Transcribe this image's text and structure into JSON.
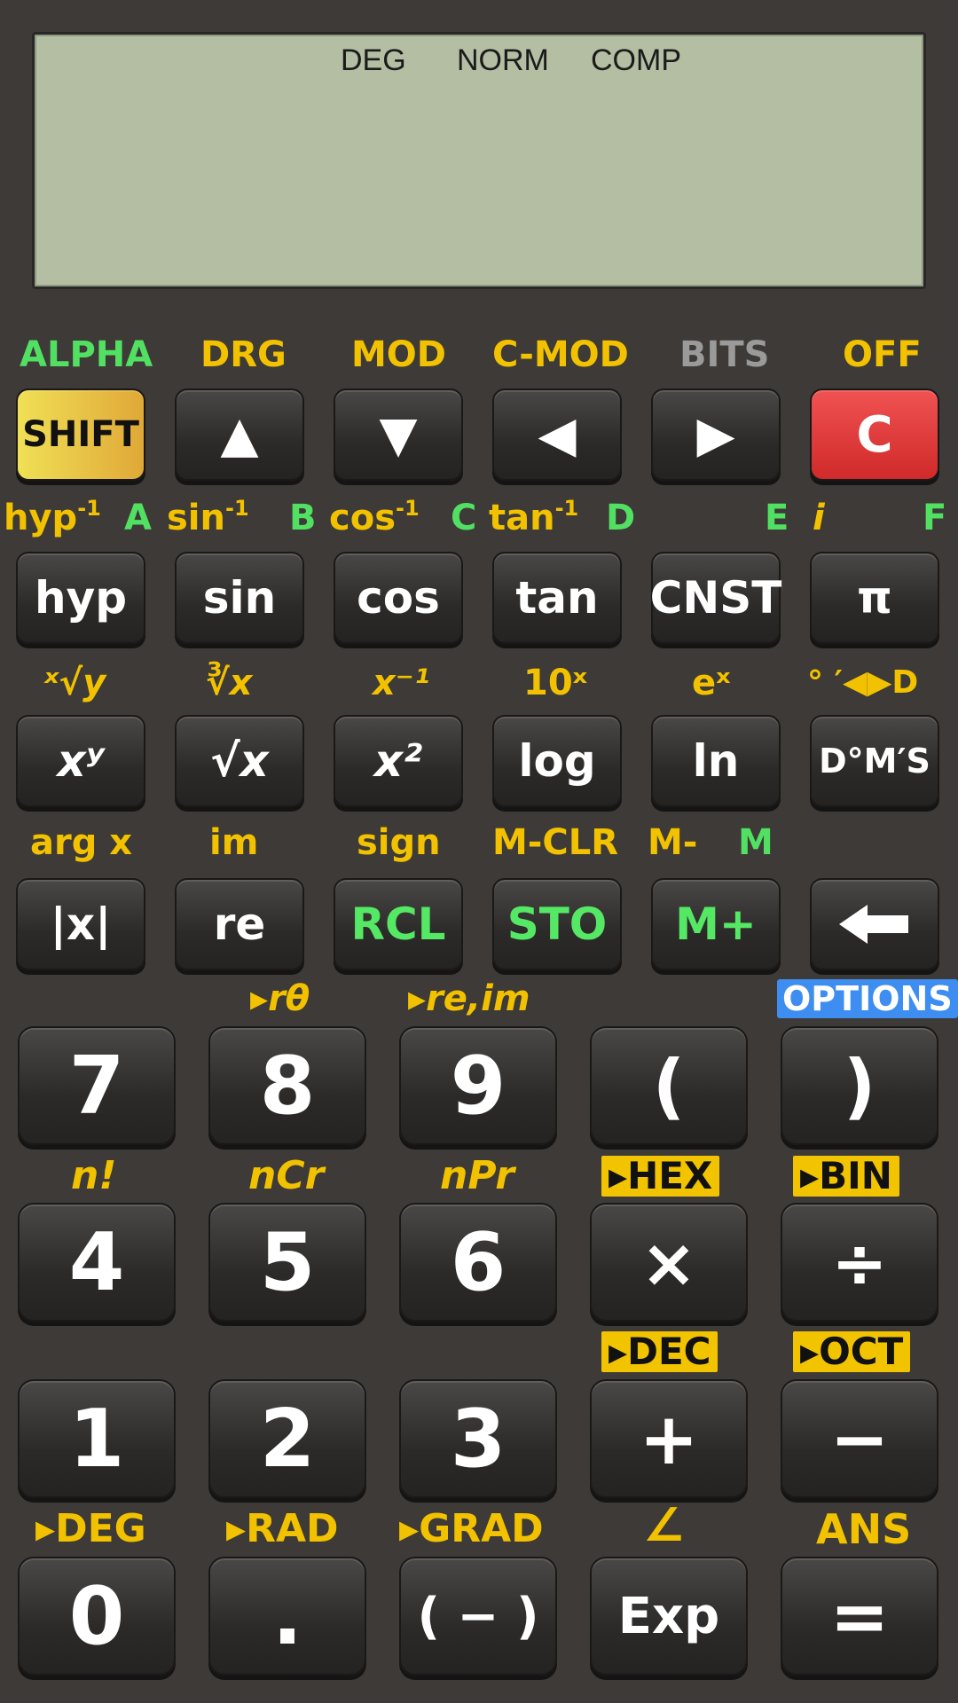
{
  "display": {
    "status": [
      "DEG",
      "NORM",
      "COMP"
    ]
  },
  "row1": {
    "labels": [
      "ALPHA",
      "DRG",
      "MOD",
      "C-MOD",
      "BITS",
      "OFF"
    ],
    "keys": [
      "SHIFT",
      "▲",
      "▼",
      "◀",
      "▶",
      "C"
    ]
  },
  "row2": {
    "labels": {
      "hyp_inv": "hyp",
      "sin_inv": "sin",
      "cos_inv": "cos",
      "tan_inv": "tan",
      "inv_sup": "-1",
      "A": "A",
      "B": "B",
      "C": "C",
      "D": "D",
      "E": "E",
      "i": "i",
      "F": "F"
    },
    "keys": [
      "hyp",
      "sin",
      "cos",
      "tan",
      "CNST",
      "π"
    ]
  },
  "row3": {
    "labels": [
      "ˣ√y",
      "∛x",
      "x⁻¹",
      "10ˣ",
      "eˣ",
      "° ′◀▶D"
    ],
    "keys": [
      "xʸ",
      "√x",
      "x²",
      "log",
      "ln",
      "D°M′S"
    ]
  },
  "row4": {
    "labels": {
      "argx": "arg x",
      "im": "im",
      "sign": "sign",
      "mclr": "M-CLR",
      "mminus": "M-",
      "m": "M"
    },
    "keys": [
      "|x|",
      "re",
      "RCL",
      "STO",
      "M+",
      "backspace"
    ]
  },
  "row5": {
    "labels": {
      "rtheta": "▸rθ",
      "reim": "▸re,im",
      "options": "OPTIONS"
    },
    "keys": [
      "7",
      "8",
      "9",
      "(",
      ")"
    ]
  },
  "row6": {
    "labels": {
      "fact": "n!",
      "ncr": "nCr",
      "npr": "nPr",
      "hex": "▸HEX",
      "bin": "▸BIN"
    },
    "keys": [
      "4",
      "5",
      "6",
      "×",
      "÷"
    ]
  },
  "row7": {
    "labels": {
      "dec": "▸DEC",
      "oct": "▸OCT"
    },
    "keys": [
      "1",
      "2",
      "3",
      "+",
      "−"
    ]
  },
  "row8": {
    "labels": {
      "deg": "▸DEG",
      "rad": "▸RAD",
      "grad": "▸GRAD",
      "angle": "∠",
      "ans": "ANS"
    },
    "keys": [
      "0",
      ".",
      "( − )",
      "Exp",
      "="
    ]
  },
  "colors": {
    "background": "#3d3a37",
    "lcd": "#b3bea3",
    "shift_label": "#f2c200",
    "alpha_label": "#52e062",
    "clear_key": "#e03a3a",
    "options_badge": "#3d8ef0"
  }
}
